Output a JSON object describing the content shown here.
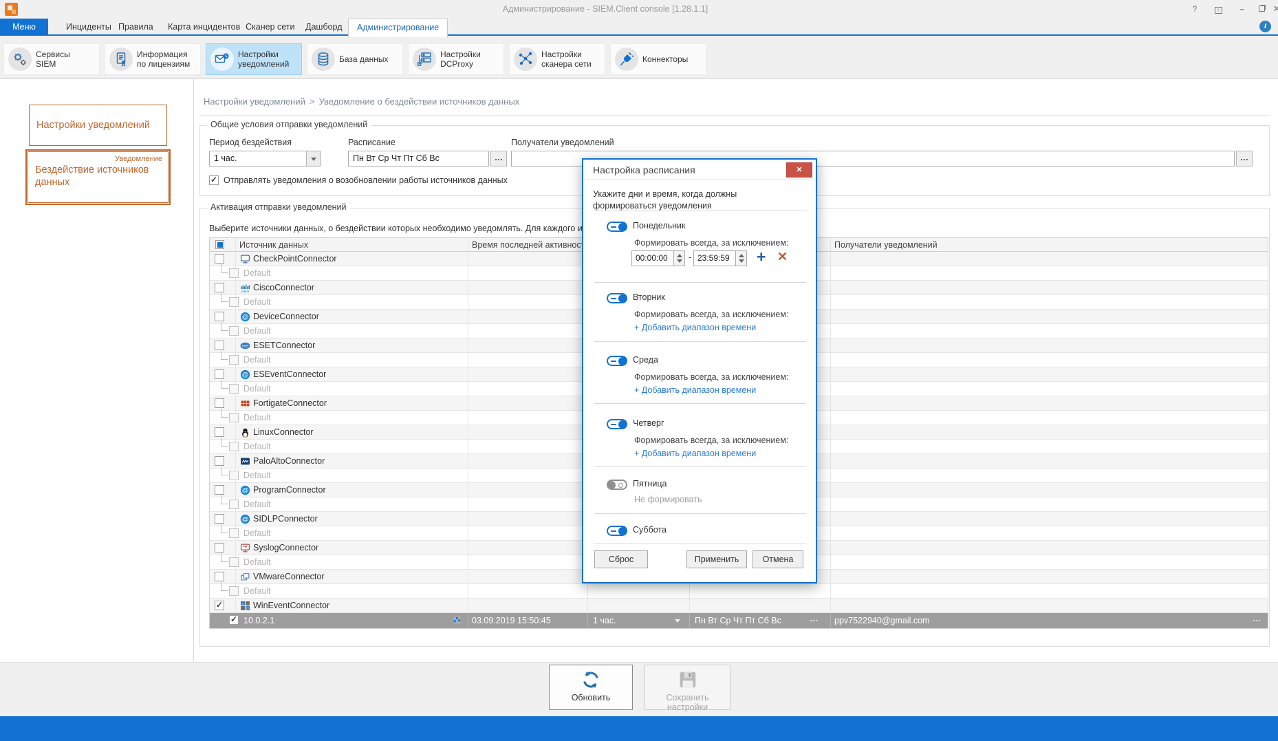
{
  "window": {
    "title": "Администрирование - SIEM.Client console [1.28.1.1]",
    "controls": {
      "help": "?",
      "minimize": "–",
      "close": "✕"
    }
  },
  "tabs": {
    "menu": "Меню",
    "items": [
      "Инциденты",
      "Правила",
      "Карта инцидентов",
      "Сканер сети",
      "Дашборд"
    ],
    "active": "Администрирование"
  },
  "toolbar": {
    "buttons": [
      {
        "icon": "gears-icon",
        "line1": "Сервисы",
        "line2": "SIEM"
      },
      {
        "icon": "license-icon",
        "line1": "Информация",
        "line2": "по лицензиям"
      },
      {
        "icon": "mail-bell-icon",
        "line1": "Настройки",
        "line2": "уведомлений",
        "selected": true
      },
      {
        "icon": "database-icon",
        "line1": "База данных",
        "line2": ""
      },
      {
        "icon": "server-icon",
        "line1": "Настройки",
        "line2": "DCProxy"
      },
      {
        "icon": "network-icon",
        "line1": "Настройки",
        "line2": "сканера сети"
      },
      {
        "icon": "plug-icon",
        "line1": "Коннекторы",
        "line2": ""
      }
    ]
  },
  "sidebar": {
    "item1": "Настройки уведомлений",
    "item2_badge": "Уведомление",
    "item2_label": "Бездействие источников данных"
  },
  "breadcrumb": {
    "part1": "Настройки уведомлений",
    "separator": ">",
    "part2": "Уведомление о бездействии источников данных"
  },
  "general": {
    "legend": "Общие условия отправки уведомлений",
    "period_label": "Период бездействия",
    "period_value": "1 час.",
    "schedule_label": "Расписание",
    "schedule_value": "Пн Вт Ср Чт Пт Сб Вс",
    "ellipsis": "…",
    "recipients_label": "Получатели уведомлений",
    "recipients_value": "",
    "resume_label": "Отправлять уведомления о возобновлении работы источников данных"
  },
  "activation": {
    "legend": "Активация отправки уведомлений",
    "instruction": "Выберите источники данных, о бездействии которых необходимо уведомлять. Для каждого источник",
    "table": {
      "columns": [
        "Источник данных",
        "Время последней активности",
        "Получатели уведомлений"
      ],
      "child_label": "Default",
      "connectors": [
        {
          "name": "CheckPointConnector",
          "icon": "monitor-blue"
        },
        {
          "name": "CiscoConnector",
          "icon": "cisco"
        },
        {
          "name": "DeviceConnector",
          "icon": "at-circle"
        },
        {
          "name": "ESETConnector",
          "icon": "eset"
        },
        {
          "name": "ESEventConnector",
          "icon": "at-circle"
        },
        {
          "name": "FortigateConnector",
          "icon": "fortinet-grid"
        },
        {
          "name": "LinuxConnector",
          "icon": "penguin"
        },
        {
          "name": "PaloAltoConnector",
          "icon": "paloalto"
        },
        {
          "name": "ProgramConnector",
          "icon": "at-circle"
        },
        {
          "name": "SIDLPConnector",
          "icon": "at-circle"
        },
        {
          "name": "SyslogConnector",
          "icon": "monitor-red"
        },
        {
          "name": "VMwareConnector",
          "icon": "vmware"
        },
        {
          "name": "WinEventConnector",
          "icon": "win-grid",
          "checked": true,
          "has_child_default": false
        }
      ],
      "selected_row": {
        "ip": "10.0.2.1",
        "last_activity": "03.09.2019 15:50:45",
        "period": "1 час.",
        "schedule": "Пн Вт Ср Чт Пт Сб Вс",
        "ellipsis": "…",
        "recipients": "ppv7522940@gmail.com"
      }
    }
  },
  "dialog": {
    "title": "Настройка расписания",
    "intro": "Укажите дни и время, когда должны формироваться уведомления",
    "always_label": "Формировать всегда, за исключением:",
    "never_label": "Не формировать",
    "add_range_link": "+ Добавить диапазон времени",
    "range": {
      "from": "00:00:00",
      "dash": "-",
      "to": "23:59:59",
      "add": "+",
      "remove": "✕"
    },
    "days": [
      {
        "name": "Понедельник",
        "enabled": true,
        "type": "range"
      },
      {
        "name": "Вторник",
        "enabled": true,
        "type": "link"
      },
      {
        "name": "Среда",
        "enabled": true,
        "type": "link"
      },
      {
        "name": "Четверг",
        "enabled": true,
        "type": "link"
      },
      {
        "name": "Пятница",
        "enabled": false,
        "type": "never"
      },
      {
        "name": "Суббота",
        "enabled": true,
        "type": "none"
      }
    ],
    "buttons": {
      "reset": "Сброс",
      "apply": "Применить",
      "cancel": "Отмена"
    },
    "close": "✕"
  },
  "footer": {
    "refresh": "Обновить",
    "save": "Сохранить настройки"
  },
  "colors": {
    "accent_blue": "#1272d4",
    "highlight_blue": "#bfe2f8",
    "sidebar_orange": "#c0662c",
    "close_red": "#ca5146",
    "selected_row_gray": "#9e9e9e"
  }
}
